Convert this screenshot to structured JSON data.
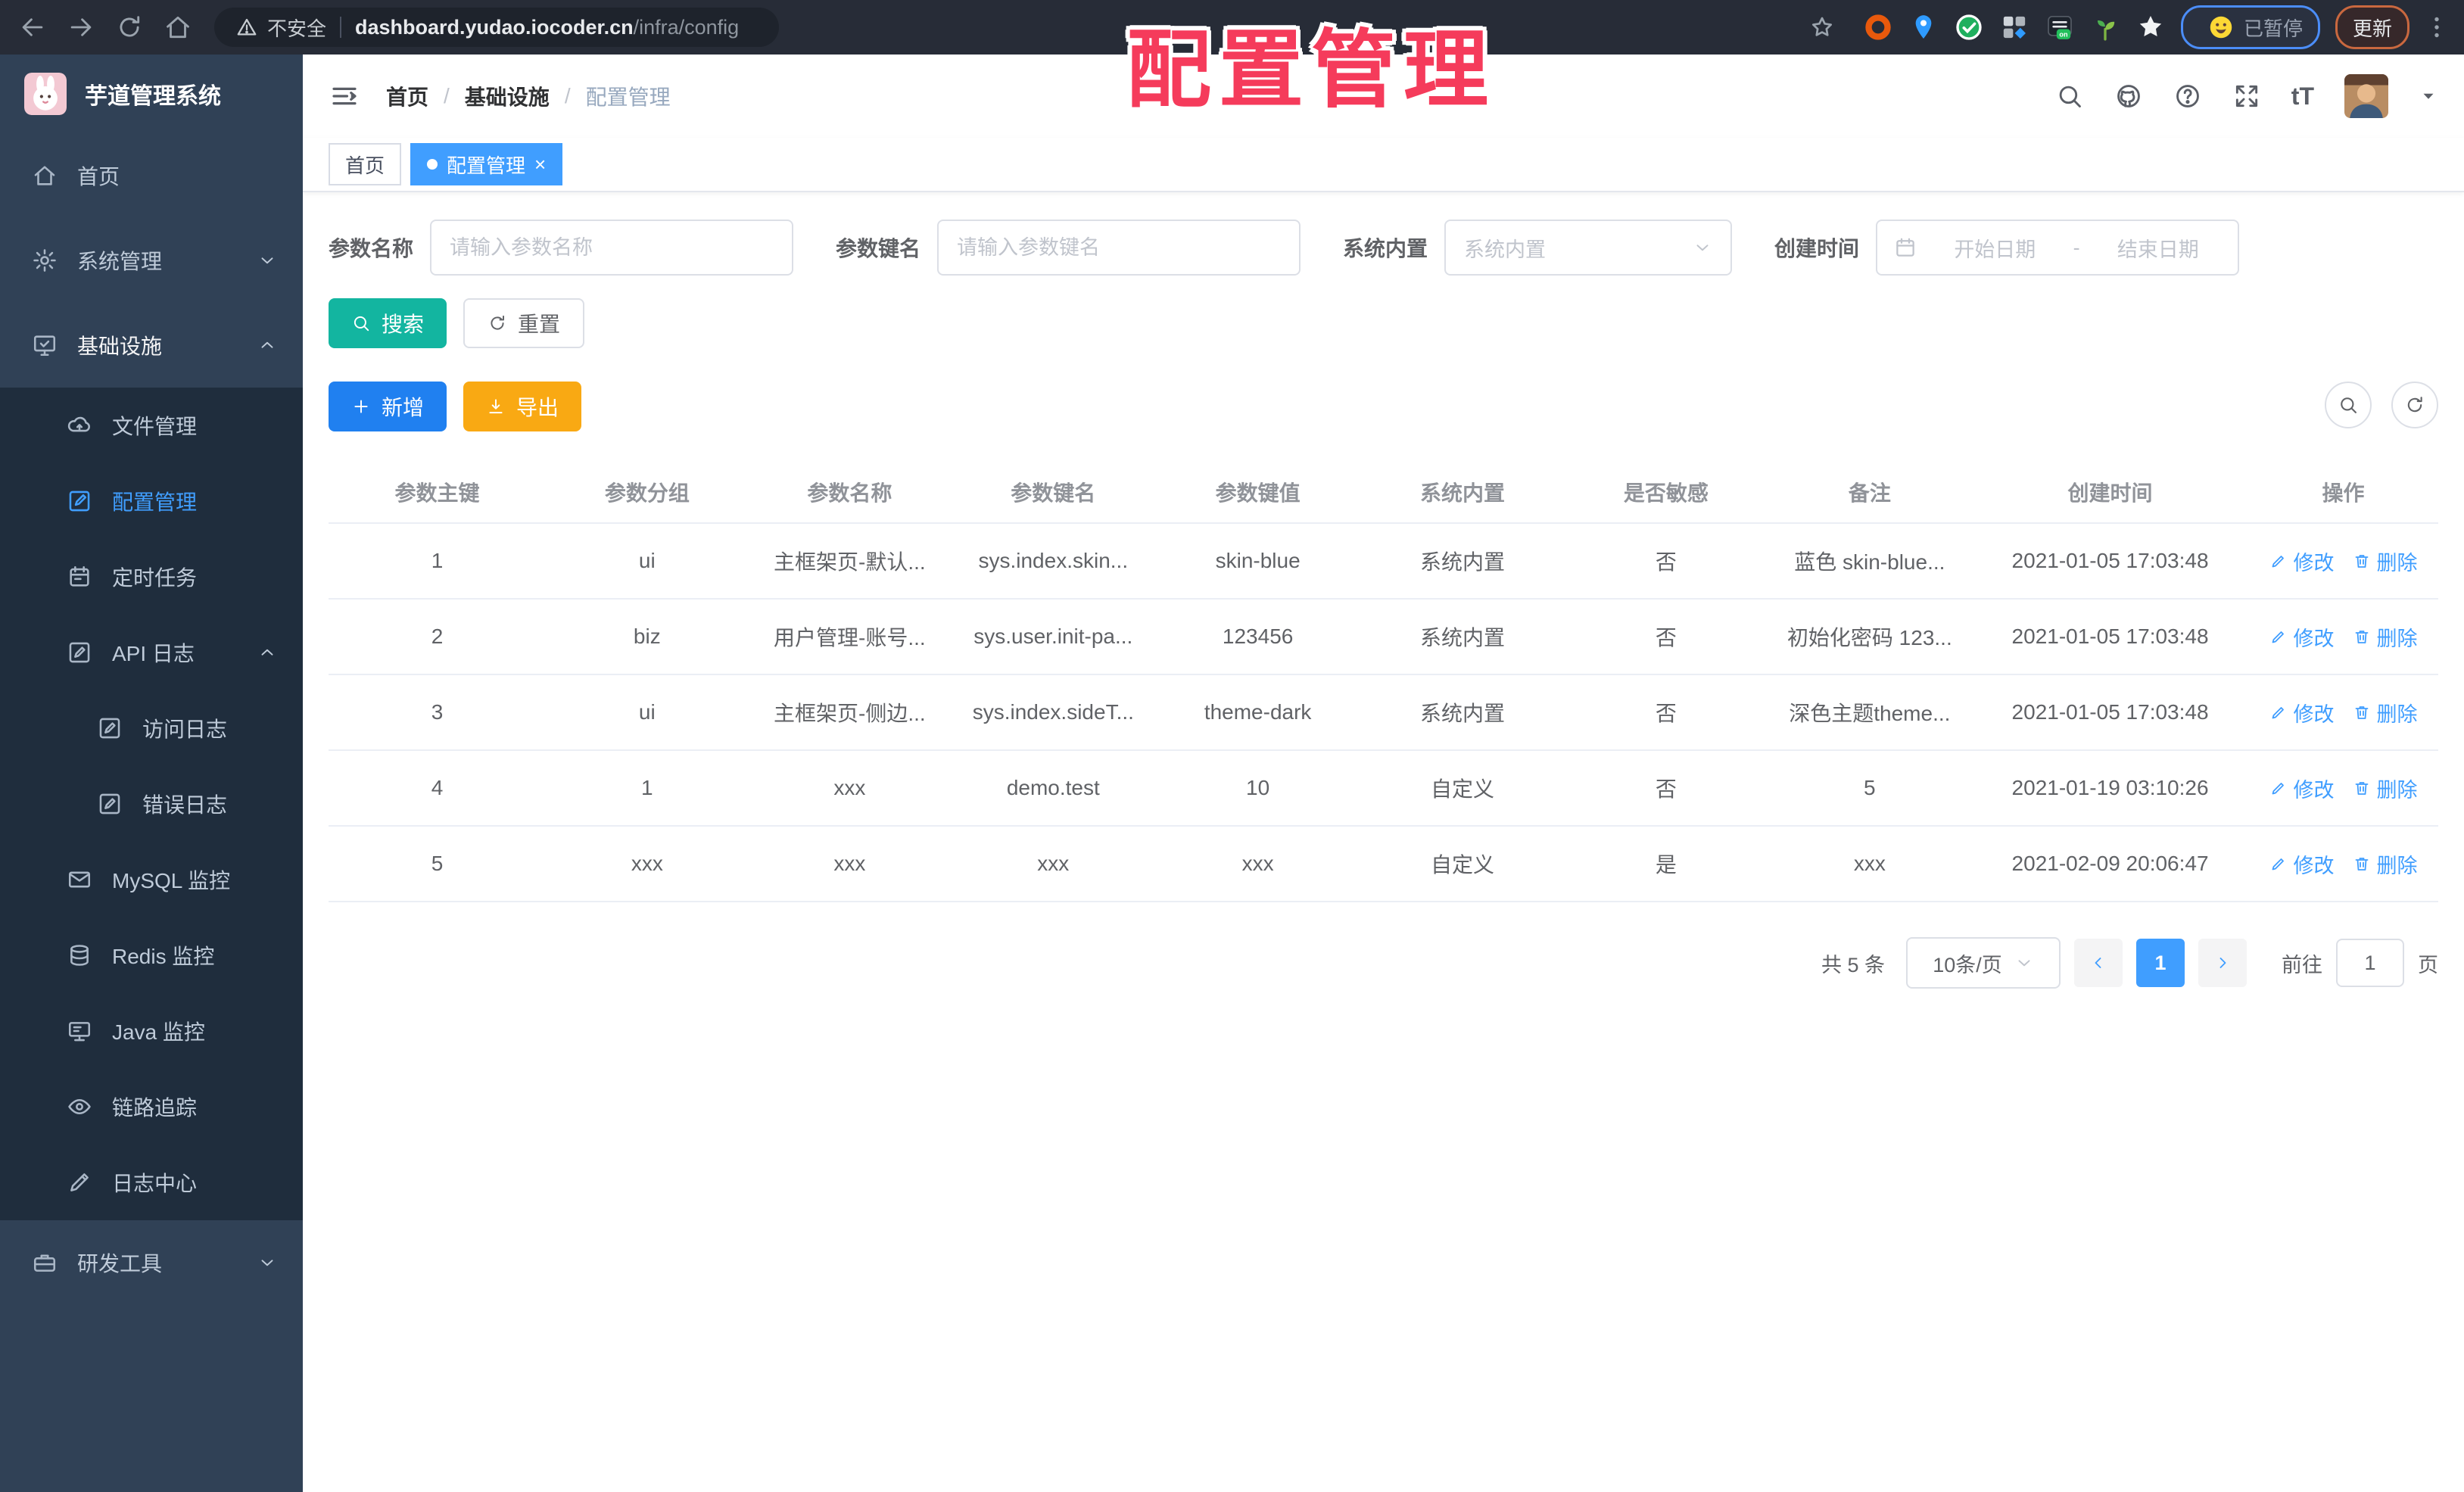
{
  "colors": {
    "primary": "#409eff",
    "teal": "#13b5a0",
    "add_blue": "#2080f0",
    "export_amber": "#f9a913",
    "overlay_red": "#f53b5b",
    "sidebar_bg": "#304156",
    "submenu_bg": "#1f2d3d"
  },
  "browser": {
    "security_label": "不安全",
    "url_host": "dashboard.yudao.iocoder.cn",
    "url_path": "/infra/config",
    "paused_label": "已暂停",
    "update_label": "更新"
  },
  "overlay_title": "配置管理",
  "sidebar": {
    "logo_title": "芋道管理系统",
    "items": [
      {
        "label": "首页",
        "icon": "home-icon",
        "level": 1
      },
      {
        "label": "系统管理",
        "icon": "gear-icon",
        "level": 1,
        "chevron": "down"
      },
      {
        "label": "基础设施",
        "icon": "monitor-icon",
        "level": 1,
        "chevron": "up",
        "open": true
      },
      {
        "label": "文件管理",
        "icon": "cloud-upload-icon",
        "level": 2
      },
      {
        "label": "配置管理",
        "icon": "edit-square-icon",
        "level": 2,
        "active": true
      },
      {
        "label": "定时任务",
        "icon": "schedule-icon",
        "level": 2
      },
      {
        "label": "API 日志",
        "icon": "doc-edit-icon",
        "level": 2,
        "chevron": "up"
      },
      {
        "label": "访问日志",
        "icon": "doc-edit-icon",
        "level": 3
      },
      {
        "label": "错误日志",
        "icon": "doc-edit-icon",
        "level": 3
      },
      {
        "label": "MySQL 监控",
        "icon": "mail-icon",
        "level": 2
      },
      {
        "label": "Redis 监控",
        "icon": "database-icon",
        "level": 2
      },
      {
        "label": "Java 监控",
        "icon": "screen-icon",
        "level": 2
      },
      {
        "label": "链路追踪",
        "icon": "eye-icon",
        "level": 2
      },
      {
        "label": "日志中心",
        "icon": "pen-icon",
        "level": 2
      },
      {
        "label": "研发工具",
        "icon": "briefcase-icon",
        "level": 1,
        "chevron": "down"
      }
    ]
  },
  "header": {
    "breadcrumb": [
      "首页",
      "基础设施",
      "配置管理"
    ]
  },
  "tabs": [
    {
      "label": "首页",
      "active": false,
      "closable": false
    },
    {
      "label": "配置管理",
      "active": true,
      "closable": true,
      "dot": true
    }
  ],
  "filters": {
    "name_label": "参数名称",
    "name_placeholder": "请输入参数名称",
    "key_label": "参数键名",
    "key_placeholder": "请输入参数键名",
    "type_label": "系统内置",
    "type_placeholder": "系统内置",
    "date_label": "创建时间",
    "date_start": "开始日期",
    "date_separator": "-",
    "date_end": "结束日期",
    "search_label": "搜索",
    "reset_label": "重置"
  },
  "toolbar": {
    "add_label": "新增",
    "export_label": "导出"
  },
  "table": {
    "headers": [
      "参数主键",
      "参数分组",
      "参数名称",
      "参数键名",
      "参数键值",
      "系统内置",
      "是否敏感",
      "备注",
      "创建时间",
      "操作"
    ],
    "rows": [
      [
        "1",
        "ui",
        "主框架页-默认...",
        "sys.index.skin...",
        "skin-blue",
        "系统内置",
        "否",
        "蓝色 skin-blue...",
        "2021-01-05 17:03:48"
      ],
      [
        "2",
        "biz",
        "用户管理-账号...",
        "sys.user.init-pa...",
        "123456",
        "系统内置",
        "否",
        "初始化密码 123...",
        "2021-01-05 17:03:48"
      ],
      [
        "3",
        "ui",
        "主框架页-侧边...",
        "sys.index.sideT...",
        "theme-dark",
        "系统内置",
        "否",
        "深色主题theme...",
        "2021-01-05 17:03:48"
      ],
      [
        "4",
        "1",
        "xxx",
        "demo.test",
        "10",
        "自定义",
        "否",
        "5",
        "2021-01-19 03:10:26"
      ],
      [
        "5",
        "xxx",
        "xxx",
        "xxx",
        "xxx",
        "自定义",
        "是",
        "xxx",
        "2021-02-09 20:06:47"
      ]
    ],
    "edit_label": "修改",
    "delete_label": "删除"
  },
  "pagination": {
    "total_label": "共 5 条",
    "page_size_label": "10条/页",
    "current_page": "1",
    "goto_label": "前往",
    "goto_value": "1",
    "page_suffix": "页"
  }
}
